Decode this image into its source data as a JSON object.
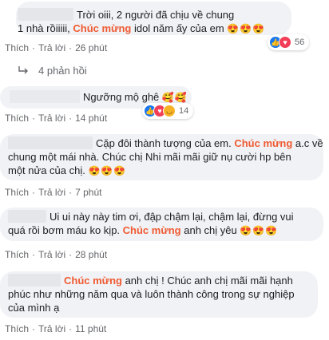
{
  "colors": {
    "bubble": "#f0f2f5",
    "highlight": "#f05a32",
    "meta": "#65676b",
    "like": "#1877f2"
  },
  "comments": [
    {
      "pre": "Trời oiii, 2 người đã chịu về chung",
      "line2": "1 nhà rồiiiii, ",
      "highlight": "Chúc mừng",
      "post": " idol năm ấy của em",
      "emojis": "😍😍😍",
      "actions": {
        "like": "Thích",
        "reply": "Trả lời",
        "time": "26 phút"
      },
      "reaction_count": "56"
    },
    {
      "pre": "Ngưỡng mộ ghê",
      "emojis": "🥰🥰",
      "actions": {
        "like": "Thích",
        "reply": "Trả lời",
        "time": "14 phút"
      },
      "reaction_count": "14"
    },
    {
      "pre": "Cặp đôi thành tượng của em. ",
      "highlight": "Chúc mừng",
      "post": " a.c về",
      "line2": "chung một mái nhà. Chúc chị Nhi mãi mãi giữ nụ cười hp bên",
      "line3": "một nửa của chị.",
      "emojis": "😍😍😍",
      "actions": {
        "like": "Thích",
        "reply": "Trả lời",
        "time": "7 phút"
      }
    },
    {
      "pre": "Ui ui này này tim ơi, đập chậm lại, chậm lại, đừng vui",
      "line2": "quá rồi bơm máu ko kịp. ",
      "highlight": "Chúc mừng",
      "post": " anh chị yêu",
      "emojis": "😍😍😍",
      "actions": {
        "like": "Thích",
        "reply": "Trả lời",
        "time": "28 phút"
      }
    },
    {
      "highlight": "Chúc mừng",
      "post": " anh chị ! Chúc anh chị mãi mãi hạnh",
      "line2": "phúc như những năm qua và luôn thành công trong sự nghiệp",
      "line3": "của mình ạ",
      "actions": {
        "like": "Thích",
        "reply": "Trả lời",
        "time": "11 phút"
      }
    }
  ],
  "replies_label": "4 phản hồi",
  "separator": "·"
}
